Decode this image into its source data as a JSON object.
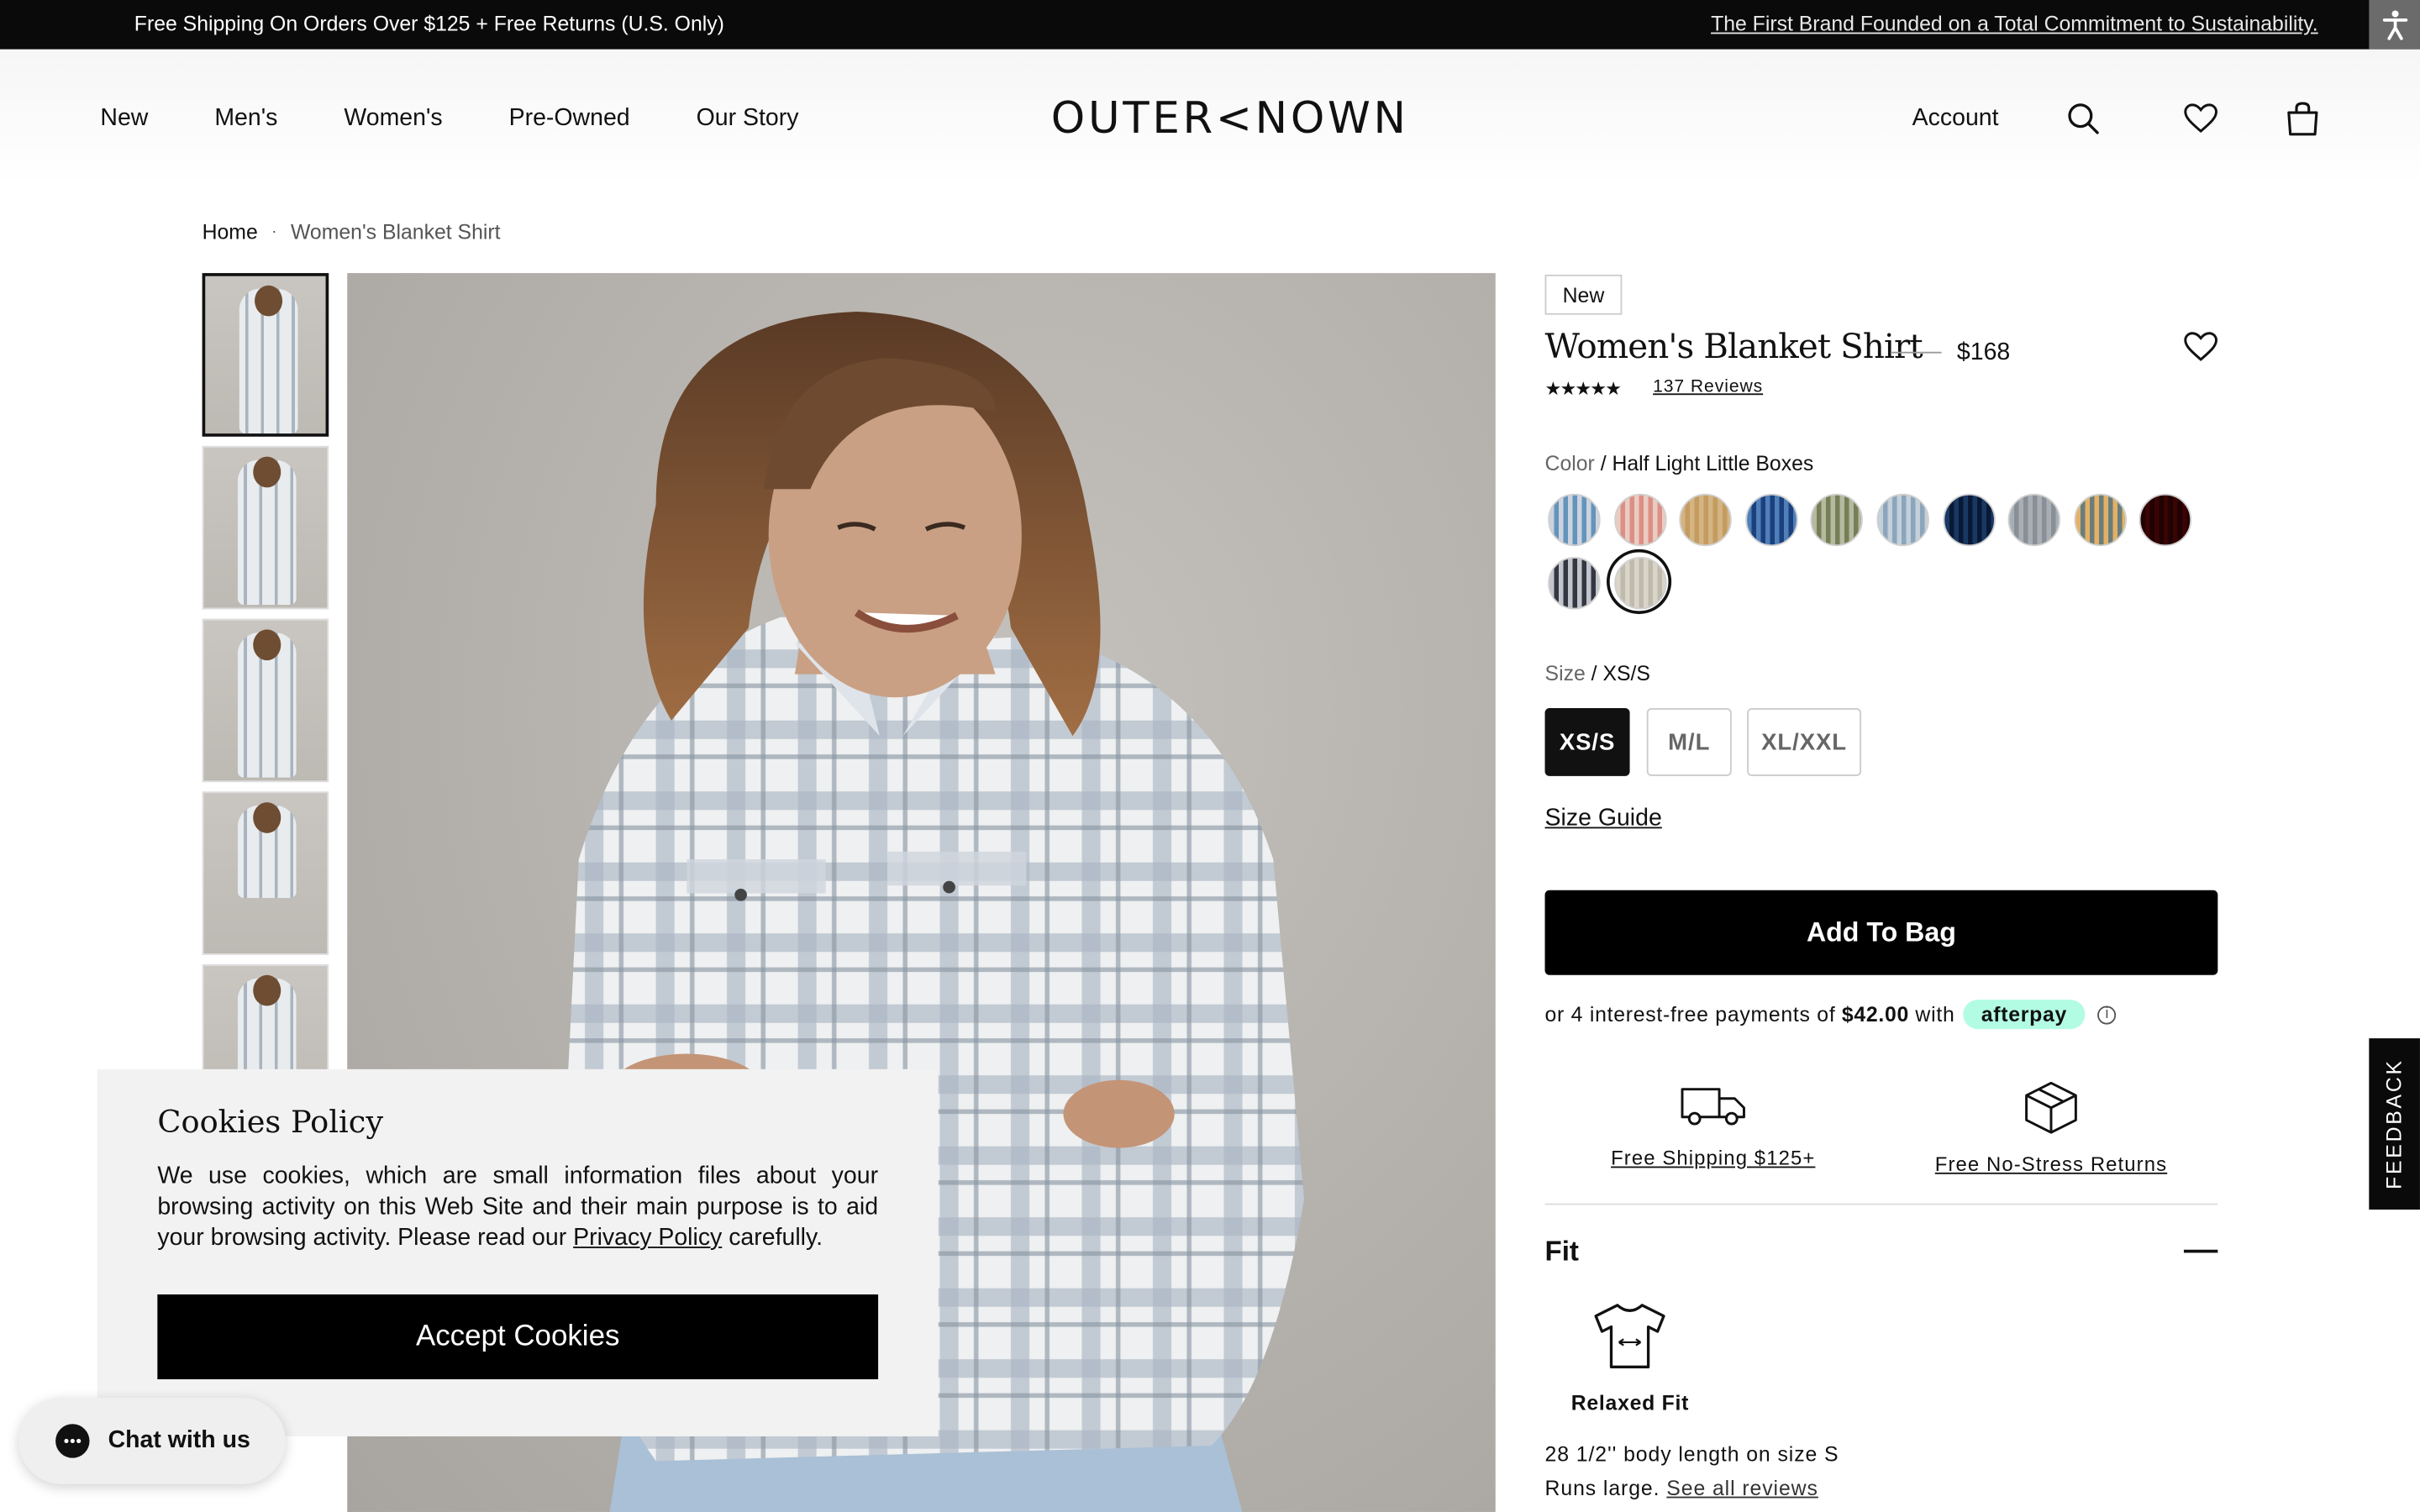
{
  "announcement": {
    "left": "Free Shipping On Orders Over $125 + Free Returns (U.S. Only)",
    "right": "The First Brand Founded on a Total Commitment to Sustainability."
  },
  "header": {
    "nav": [
      "New",
      "Men's",
      "Women's",
      "Pre-Owned",
      "Our Story"
    ],
    "logo": "OUTER<NOWN",
    "account": "Account"
  },
  "breadcrumb": {
    "home": "Home",
    "separator": "·",
    "current": "Women's Blanket Shirt"
  },
  "product": {
    "badge": "New",
    "title": "Women's Blanket Shirt",
    "price": "$168",
    "stars": "★★★★★",
    "rating": 4.8,
    "reviews": "137 Reviews",
    "color_label": "Color",
    "color_value": " / Half Light Little Boxes",
    "swatches": [
      {
        "color": "#6fa3c9",
        "alt": "#e4e8ee"
      },
      {
        "color": "#e7a09a",
        "alt": "#f4e4de"
      },
      {
        "color": "#d7b987",
        "alt": "#e8d6b6"
      },
      {
        "color": "#2f5c94",
        "alt": "#8fb4d9"
      },
      {
        "color": "#8b956e",
        "alt": "#d7d9c9"
      },
      {
        "color": "#9fb7cb",
        "alt": "#dfe6ec"
      },
      {
        "color": "#1c3552",
        "alt": "#4f78a0"
      },
      {
        "color": "#a7adb3",
        "alt": "#cfd3d6"
      },
      {
        "color": "#6f98c2",
        "alt": "#f1d4a2"
      },
      {
        "color": "#a52126",
        "alt": "#5a1818"
      },
      {
        "color": "#3b3e4a",
        "alt": "#dfe0e4"
      },
      {
        "color": "#cfcbc2",
        "alt": "#ece9e3"
      }
    ],
    "selected_swatch": 11,
    "size_label": "Size",
    "size_value": " / XS/S",
    "sizes": [
      "XS/S",
      "M/L",
      "XL/XXL"
    ],
    "selected_size": "XS/S",
    "size_guide": "Size Guide",
    "add_to_bag": "Add To Bag",
    "afterpay": {
      "prefix": "or 4 interest-free payments of",
      "amount": "$42.00",
      "suffix": "with",
      "brand": "afterpay",
      "info": "i"
    },
    "perks": [
      "Free Shipping $125+",
      "Free No-Stress Returns"
    ],
    "fit": {
      "title": "Fit",
      "name": "Relaxed Fit",
      "body": "28 1/2'' body length on size S",
      "runs": "Runs large.",
      "see_reviews": "See all reviews"
    }
  },
  "feedback": "FEEDBACK",
  "cookie": {
    "title": "Cookies Policy",
    "text_before": "We use cookies, which are small information files about your browsing activity on this Web Site and their main purpose is to aid your browsing activity. Please read our ",
    "link": "Privacy Policy",
    "text_after": " carefully.",
    "accept": "Accept Cookies"
  },
  "chat": {
    "label": "Chat with us"
  },
  "colors": {
    "accent": "#000000",
    "afterpay_mint": "#b2fce4",
    "announce_bg": "#0a0a0a"
  }
}
